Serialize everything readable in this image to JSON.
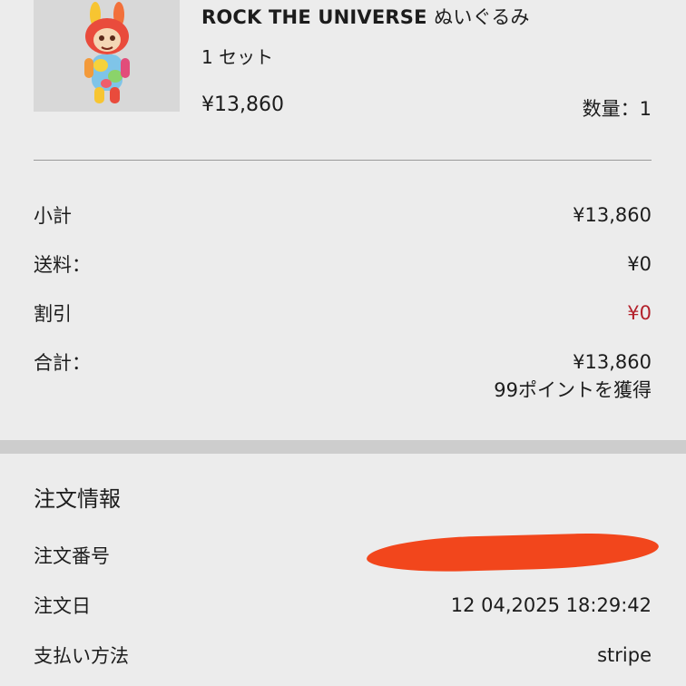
{
  "product": {
    "title": "ROCK THE UNIVERSE",
    "title_suffix": "ぬいぐるみ",
    "variant": "1 セット",
    "price": "¥13,860",
    "quantity": "数量：1",
    "image_icon": "plush-toy-image"
  },
  "summary": {
    "rows": [
      {
        "label": "小計",
        "value": "¥13,860"
      },
      {
        "label": "送料：",
        "value": "¥0"
      },
      {
        "label": "割引",
        "value": "¥0"
      },
      {
        "label": "合計：",
        "value": "¥13,860"
      }
    ],
    "points": "99ポイントを獲得",
    "discount_color": "#b3202a"
  },
  "order_info": {
    "heading": "注文情報",
    "number_label": "注文番号",
    "date_label": "注文日",
    "date_value": "12 04,2025 18:29:42",
    "payment_label": "支払い方法",
    "payment_value": "stripe",
    "redaction_color": "#f2461c"
  }
}
